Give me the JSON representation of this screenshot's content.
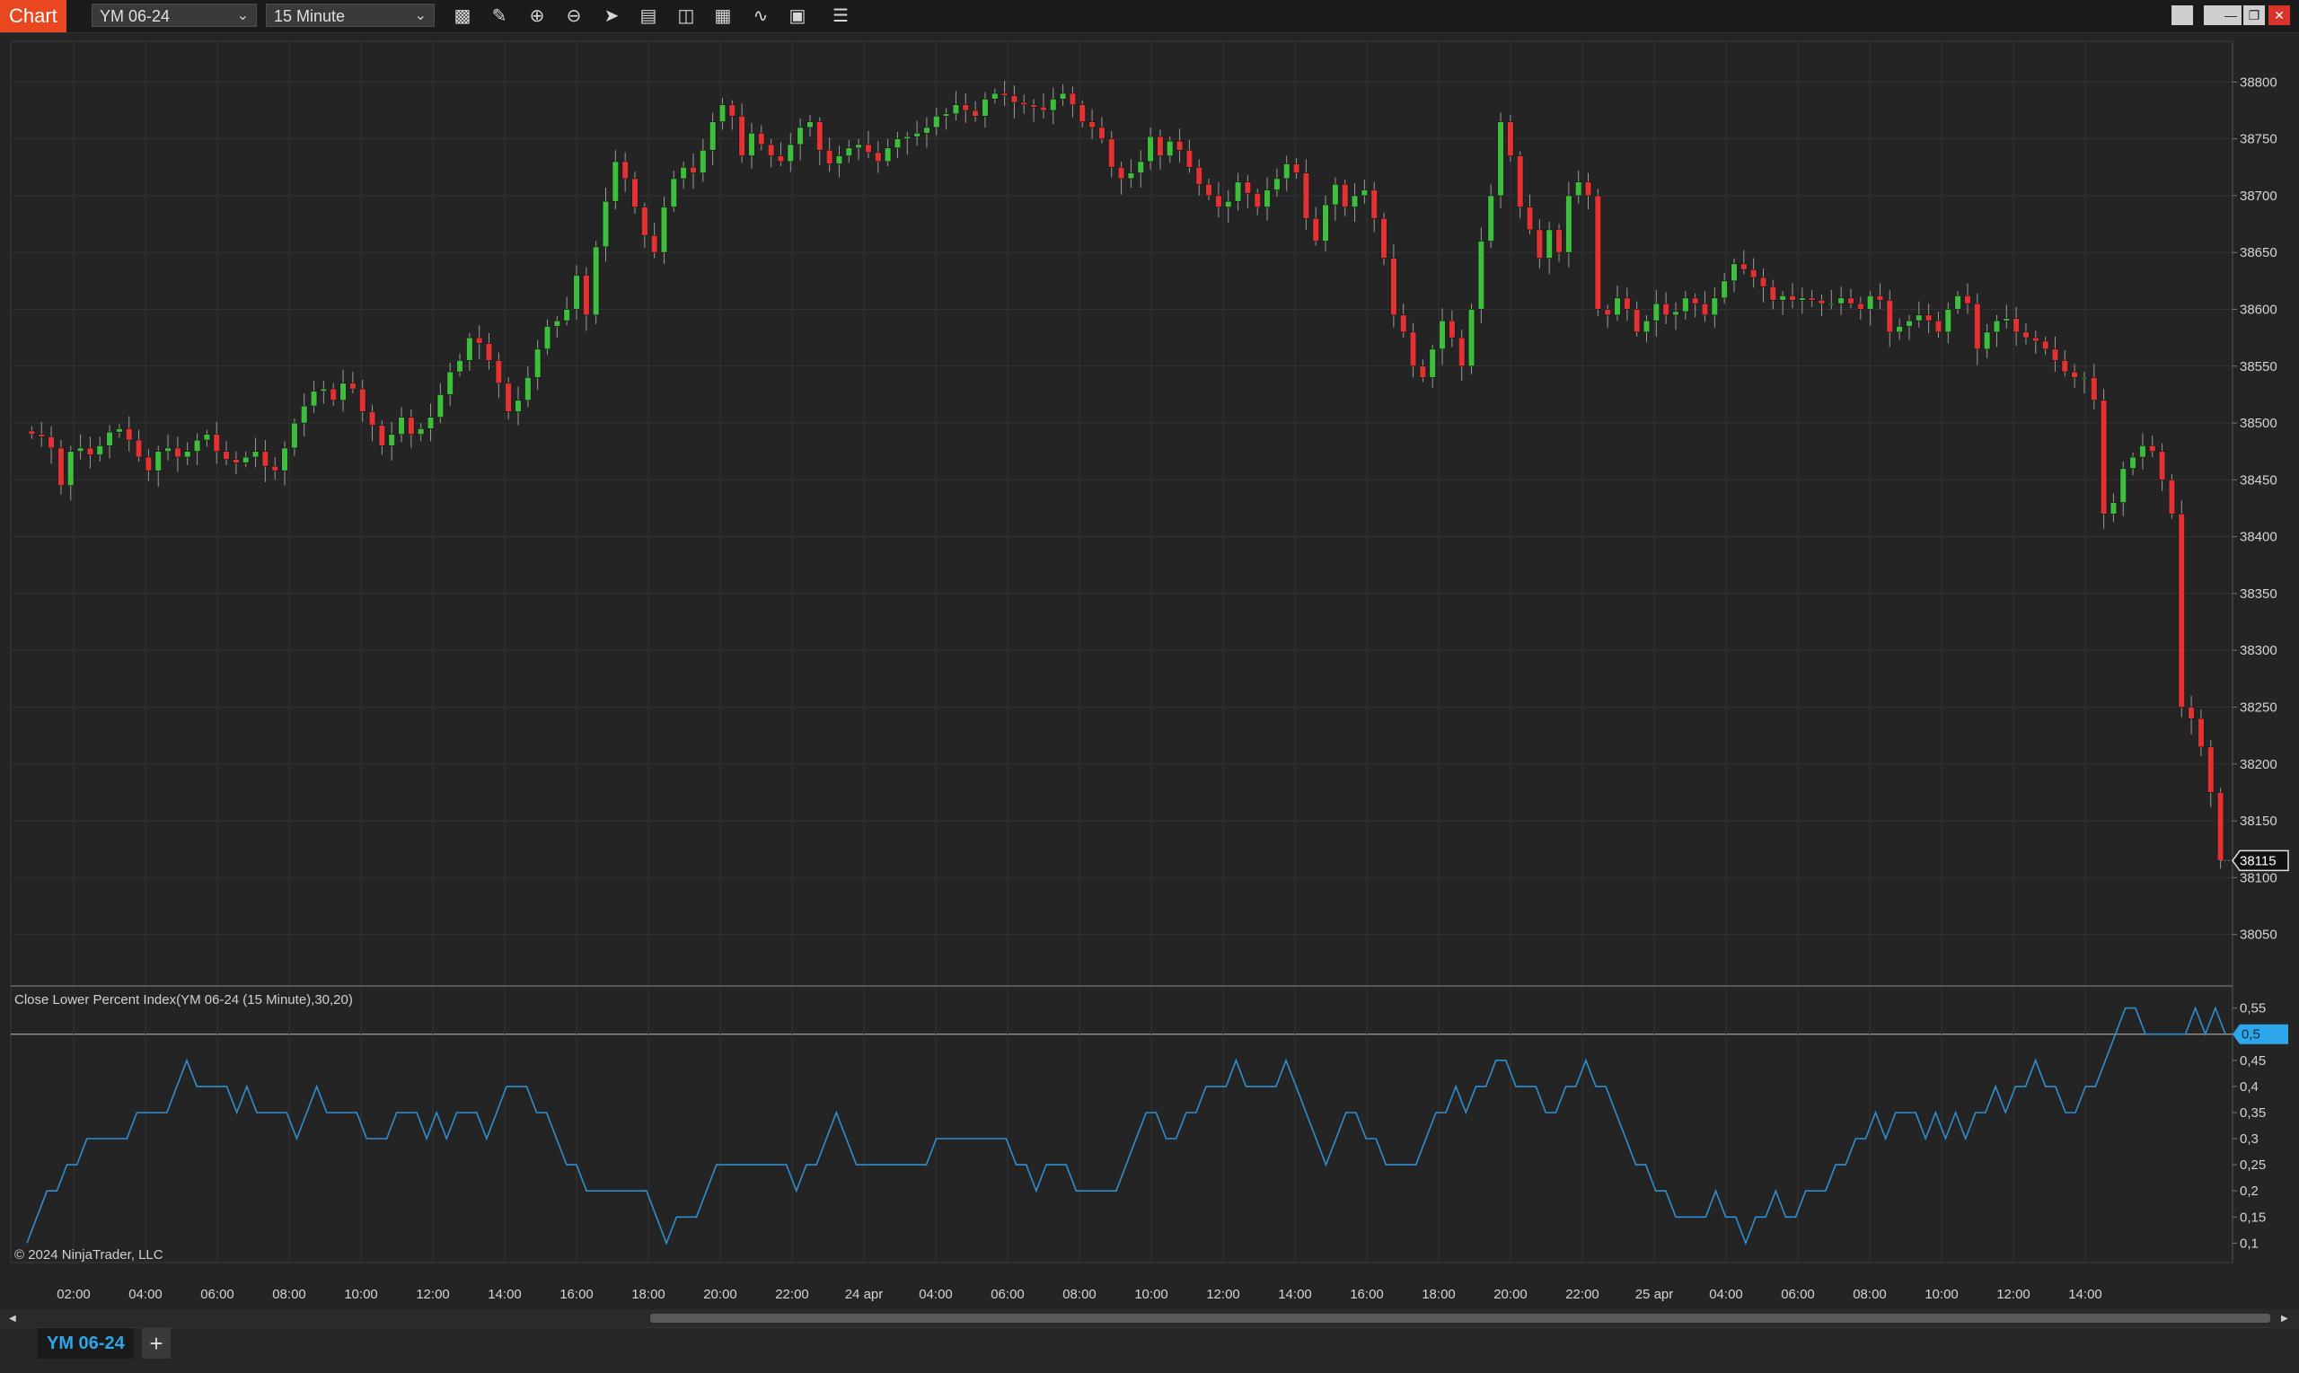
{
  "app": {
    "title": "Chart",
    "instrument": "YM 06-24",
    "interval": "15 Minute",
    "instrument_tab": "YM 06-24",
    "add_tab": "+"
  },
  "toolbar_icons": [
    "bar-type-icon",
    "drawing-tool-icon",
    "zoom-in-icon",
    "zoom-out-icon",
    "pointer-icon",
    "data-box-icon",
    "indicators-icon",
    "strategies-icon",
    "chart-trader-icon",
    "properties-icon",
    "list-icon"
  ],
  "window_buttons": [
    "tile-icon",
    "tile-icon",
    "minimize-icon",
    "restore-icon",
    "close-icon"
  ],
  "colors": {
    "background": "#242424",
    "grid": "#333333",
    "up": "#3dbf3d",
    "down": "#e23232",
    "wick": "#9a9a9a",
    "indicator": "#2e8fd0",
    "accent": "#e8471f",
    "marker": "#2ea6ea"
  },
  "chart_data": [
    {
      "type": "candlestick",
      "instrument": "YM 06-24",
      "interval": "15 Minute",
      "ylim": [
        38030,
        38820
      ],
      "yticks": [
        38050,
        38100,
        38150,
        38200,
        38250,
        38300,
        38350,
        38400,
        38450,
        38500,
        38550,
        38600,
        38650,
        38700,
        38750,
        38800
      ],
      "last_price": "38115",
      "closes": [
        38490,
        38488,
        38478,
        38445,
        38475,
        38478,
        38472,
        38480,
        38492,
        38495,
        38485,
        38470,
        38458,
        38475,
        38478,
        38470,
        38475,
        38485,
        38490,
        38475,
        38468,
        38465,
        38470,
        38475,
        38462,
        38458,
        38478,
        38500,
        38515,
        38528,
        38530,
        38520,
        38535,
        38530,
        38510,
        38498,
        38480,
        38490,
        38505,
        38490,
        38495,
        38505,
        38525,
        38545,
        38555,
        38575,
        38570,
        38555,
        38535,
        38510,
        38520,
        38540,
        38565,
        38585,
        38590,
        38600,
        38630,
        38595,
        38655,
        38695,
        38730,
        38715,
        38690,
        38665,
        38650,
        38690,
        38715,
        38725,
        38720,
        38740,
        38765,
        38780,
        38770,
        38735,
        38755,
        38745,
        38735,
        38730,
        38745,
        38760,
        38765,
        38740,
        38728,
        38735,
        38742,
        38745,
        38738,
        38730,
        38742,
        38750,
        38752,
        38755,
        38760,
        38770,
        38772,
        38780,
        38775,
        38770,
        38785,
        38790,
        38788,
        38782,
        38780,
        38778,
        38775,
        38785,
        38790,
        38780,
        38765,
        38760,
        38750,
        38725,
        38715,
        38720,
        38730,
        38752,
        38735,
        38748,
        38740,
        38725,
        38710,
        38700,
        38690,
        38695,
        38712,
        38702,
        38690,
        38705,
        38715,
        38728,
        38720,
        38680,
        38660,
        38692,
        38710,
        38690,
        38700,
        38705,
        38680,
        38645,
        38595,
        38580,
        38550,
        38540,
        38565,
        38590,
        38575,
        38550,
        38600,
        38660,
        38700,
        38765,
        38735,
        38690,
        38670,
        38645,
        38670,
        38650,
        38700,
        38712,
        38700,
        38600,
        38595,
        38610,
        38600,
        38580,
        38590,
        38605,
        38595,
        38598,
        38610,
        38605,
        38595,
        38610,
        38625,
        38640,
        38635,
        38628,
        38620,
        38608,
        38612,
        38608,
        38610,
        38608,
        38605,
        38605,
        38610,
        38605,
        38600,
        38612,
        38608,
        38580,
        38585,
        38590,
        38595,
        38590,
        38580,
        38600,
        38612,
        38605,
        38565,
        38580,
        38590,
        38592,
        38580,
        38575,
        38572,
        38565,
        38555,
        38545,
        38540,
        38540,
        38520,
        38420,
        38430,
        38460,
        38470,
        38480,
        38475,
        38450,
        38420,
        38250,
        38240,
        38215,
        38175,
        38115
      ]
    },
    {
      "type": "line",
      "name": "Close Lower Percent Index(YM 06-24 (15 Minute),30,20)",
      "ylim": [
        0.08,
        0.57
      ],
      "yticks": [
        "0,1",
        "0,15",
        "0,2",
        "0,25",
        "0,3",
        "0,35",
        "0,4",
        "0,45",
        "0,5",
        "0,55"
      ],
      "current_value": "0,5",
      "values": [
        0.1,
        0.15,
        0.2,
        0.2,
        0.25,
        0.25,
        0.3,
        0.3,
        0.3,
        0.3,
        0.3,
        0.35,
        0.35,
        0.35,
        0.35,
        0.4,
        0.45,
        0.4,
        0.4,
        0.4,
        0.4,
        0.35,
        0.4,
        0.35,
        0.35,
        0.35,
        0.35,
        0.3,
        0.35,
        0.4,
        0.35,
        0.35,
        0.35,
        0.35,
        0.3,
        0.3,
        0.3,
        0.35,
        0.35,
        0.35,
        0.3,
        0.35,
        0.3,
        0.35,
        0.35,
        0.35,
        0.3,
        0.35,
        0.4,
        0.4,
        0.4,
        0.35,
        0.35,
        0.3,
        0.25,
        0.25,
        0.2,
        0.2,
        0.2,
        0.2,
        0.2,
        0.2,
        0.2,
        0.15,
        0.1,
        0.15,
        0.15,
        0.15,
        0.2,
        0.25,
        0.25,
        0.25,
        0.25,
        0.25,
        0.25,
        0.25,
        0.25,
        0.2,
        0.25,
        0.25,
        0.3,
        0.35,
        0.3,
        0.25,
        0.25,
        0.25,
        0.25,
        0.25,
        0.25,
        0.25,
        0.25,
        0.3,
        0.3,
        0.3,
        0.3,
        0.3,
        0.3,
        0.3,
        0.3,
        0.25,
        0.25,
        0.2,
        0.25,
        0.25,
        0.25,
        0.2,
        0.2,
        0.2,
        0.2,
        0.2,
        0.25,
        0.3,
        0.35,
        0.35,
        0.3,
        0.3,
        0.35,
        0.35,
        0.4,
        0.4,
        0.4,
        0.45,
        0.4,
        0.4,
        0.4,
        0.4,
        0.45,
        0.4,
        0.35,
        0.3,
        0.25,
        0.3,
        0.35,
        0.35,
        0.3,
        0.3,
        0.25,
        0.25,
        0.25,
        0.25,
        0.3,
        0.35,
        0.35,
        0.4,
        0.35,
        0.4,
        0.4,
        0.45,
        0.45,
        0.4,
        0.4,
        0.4,
        0.35,
        0.35,
        0.4,
        0.4,
        0.45,
        0.4,
        0.4,
        0.35,
        0.3,
        0.25,
        0.25,
        0.2,
        0.2,
        0.15,
        0.15,
        0.15,
        0.15,
        0.2,
        0.15,
        0.15,
        0.1,
        0.15,
        0.15,
        0.2,
        0.15,
        0.15,
        0.2,
        0.2,
        0.2,
        0.25,
        0.25,
        0.3,
        0.3,
        0.35,
        0.3,
        0.35,
        0.35,
        0.35,
        0.3,
        0.35,
        0.3,
        0.35,
        0.3,
        0.35,
        0.35,
        0.4,
        0.35,
        0.4,
        0.4,
        0.45,
        0.4,
        0.4,
        0.35,
        0.35,
        0.4,
        0.4,
        0.45,
        0.5,
        0.55,
        0.55,
        0.5,
        0.5,
        0.5,
        0.5,
        0.5,
        0.55,
        0.5,
        0.55,
        0.5
      ]
    }
  ],
  "x_ticks": [
    "02:00",
    "04:00",
    "06:00",
    "08:00",
    "10:00",
    "12:00",
    "14:00",
    "16:00",
    "18:00",
    "20:00",
    "22:00",
    "24 apr",
    "04:00",
    "06:00",
    "08:00",
    "10:00",
    "12:00",
    "14:00",
    "16:00",
    "18:00",
    "20:00",
    "22:00",
    "25 apr",
    "04:00",
    "06:00",
    "08:00",
    "10:00",
    "12:00",
    "14:00"
  ],
  "copyright": "© 2024 NinjaTrader, LLC"
}
